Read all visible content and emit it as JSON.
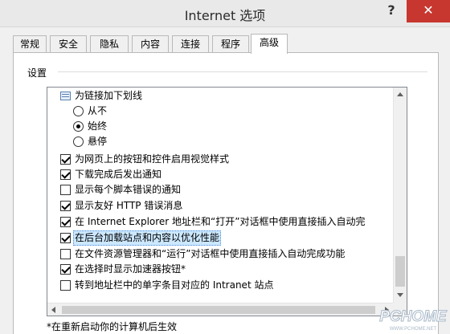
{
  "window": {
    "title": "Internet 选项",
    "help_label": "?",
    "close_label": "✕"
  },
  "tabs": [
    {
      "label": "常规"
    },
    {
      "label": "安全"
    },
    {
      "label": "隐私"
    },
    {
      "label": "内容"
    },
    {
      "label": "连接"
    },
    {
      "label": "程序"
    },
    {
      "label": "高级",
      "active": true
    }
  ],
  "settings": {
    "section_label": "设置",
    "items": [
      {
        "kind": "group",
        "icon": "underline-settings-icon",
        "label": "为链接加下划线"
      },
      {
        "kind": "radio",
        "checked": false,
        "label": "从不"
      },
      {
        "kind": "radio",
        "checked": true,
        "label": "始终"
      },
      {
        "kind": "radio",
        "checked": false,
        "label": "悬停"
      },
      {
        "kind": "checkbox",
        "checked": true,
        "label": "为网页上的按钮和控件启用视觉样式"
      },
      {
        "kind": "checkbox",
        "checked": true,
        "label": "下载完成后发出通知"
      },
      {
        "kind": "checkbox",
        "checked": false,
        "label": "显示每个脚本错误的通知"
      },
      {
        "kind": "checkbox",
        "checked": true,
        "label": "显示友好 HTTP 错误消息"
      },
      {
        "kind": "checkbox",
        "checked": true,
        "label": "在 Internet Explorer 地址栏和“打开”对话框中使用直接插入自动完"
      },
      {
        "kind": "checkbox",
        "checked": true,
        "selected": true,
        "label": "在后台加载站点和内容以优化性能"
      },
      {
        "kind": "checkbox",
        "checked": false,
        "label": "在文件资源管理器和“运行”对话框中使用直接插入自动完成功能"
      },
      {
        "kind": "checkbox",
        "checked": true,
        "label": "在选择时显示加速器按钮*"
      },
      {
        "kind": "checkbox",
        "checked": false,
        "label": "转到地址栏中的单字条目对应的 Intranet 站点"
      }
    ]
  },
  "footnote": "*在重新启动你的计算机后生效",
  "watermark": {
    "brand": "PCHOME",
    "url": "WWW.PCHOME.NET"
  },
  "colors": {
    "close_button": "#c7372f",
    "selection": "#cce8ff"
  }
}
